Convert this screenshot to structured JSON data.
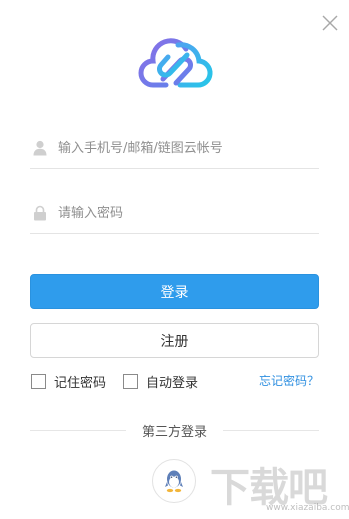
{
  "app": {
    "close_icon": "close-icon",
    "logo_icon": "cloud-link-logo",
    "brand_gradient": [
      "#2cc3e9",
      "#7c6fe4"
    ]
  },
  "form": {
    "account_placeholder": "输入手机号/邮箱/链图云帐号",
    "account_value": "",
    "account_icon": "user-icon",
    "password_placeholder": "请输入密码",
    "password_value": "",
    "password_icon": "lock-icon"
  },
  "buttons": {
    "login_label": "登录",
    "register_label": "注册",
    "login_color": "#2f9cec"
  },
  "options": {
    "remember_label": "记住密码",
    "remember_checked": false,
    "auto_login_label": "自动登录",
    "auto_login_checked": false,
    "forgot_label": "忘记密码？",
    "forgot_color": "#2f8fe0"
  },
  "third_party": {
    "label": "第三方登录",
    "providers": [
      {
        "name": "QQ",
        "icon": "qq-icon"
      }
    ]
  },
  "watermark": {
    "logo_text": "下载吧",
    "url_text": "www.xiazaiba.com"
  }
}
